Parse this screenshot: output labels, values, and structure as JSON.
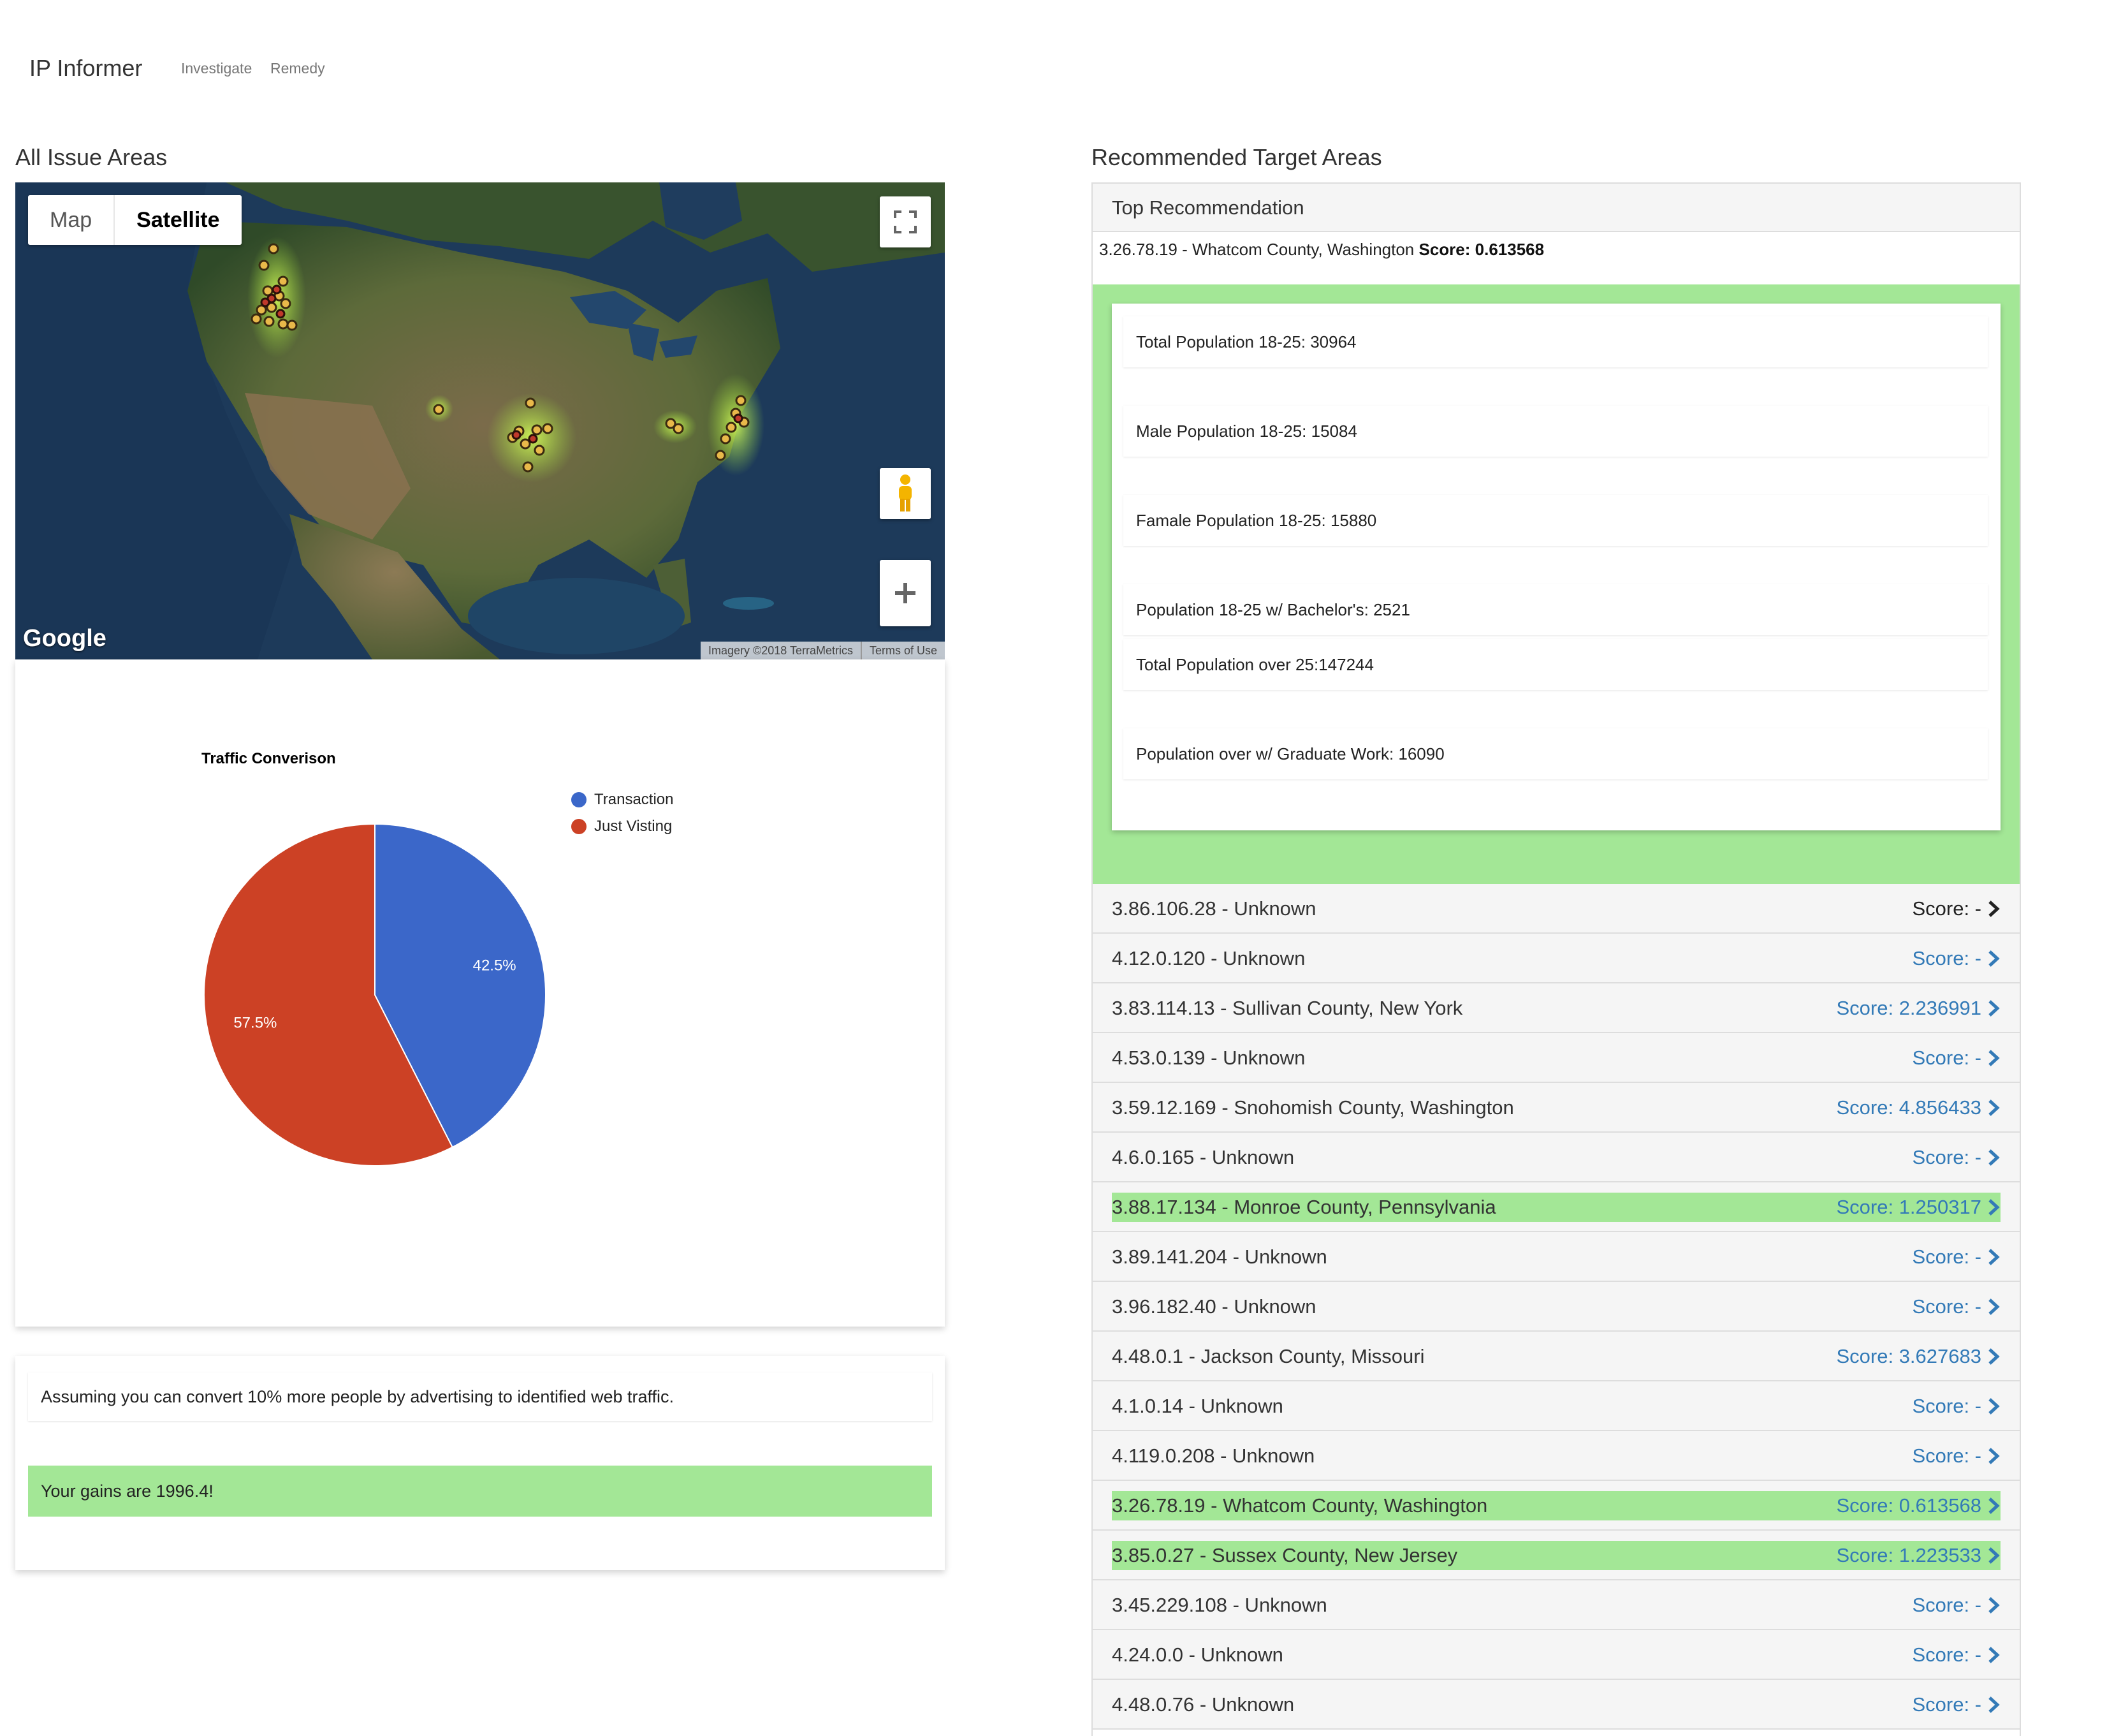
{
  "nav": {
    "brand": "IP Informer",
    "links": [
      "Investigate",
      "Remedy"
    ]
  },
  "left": {
    "title": "All Issue Areas",
    "map": {
      "type_buttons": [
        "Map",
        "Satellite"
      ],
      "active_type": "Satellite",
      "logo": "Google",
      "attribution": "Imagery ©2018 TerraMetrics",
      "terms": "Terms of Use",
      "controls": [
        "fullscreen-icon",
        "pegman-icon",
        "zoom-in-icon"
      ]
    },
    "chart": {
      "title": "Traffic Converison",
      "legend": [
        "Transaction",
        "Just Visting"
      ],
      "slice_labels": [
        "42.5%",
        "57.5%"
      ]
    },
    "gains": {
      "assumption": "Assuming you can convert 10% more people by advertising to identified web traffic.",
      "result": "Your gains are 1996.4!"
    }
  },
  "right": {
    "title": "Recommended Target Areas",
    "top_header": "Top Recommendation",
    "top_ip": "3.26.78.19 - Whatcom County, Washington",
    "top_score_label": "Score: 0.613568",
    "stats": [
      "Total Population 18-25: 30964",
      "Male Population 18-25: 15084",
      "Famale Population 18-25: 15880",
      "Population 18-25 w/ Bachelor's: 2521",
      "Total Population over 25:147244",
      "Population over w/ Graduate Work: 16090"
    ],
    "rows": [
      {
        "label": "3.86.106.28 - Unknown",
        "score": "Score: -",
        "highlight": false
      },
      {
        "label": "4.12.0.120 - Unknown",
        "score": "Score: -",
        "highlight": false
      },
      {
        "label": "3.83.114.13 - Sullivan County, New York",
        "score": "Score: 2.236991",
        "highlight": false
      },
      {
        "label": "4.53.0.139 - Unknown",
        "score": "Score: -",
        "highlight": false
      },
      {
        "label": "3.59.12.169 - Snohomish County, Washington",
        "score": "Score: 4.856433",
        "highlight": false
      },
      {
        "label": "4.6.0.165 - Unknown",
        "score": "Score: -",
        "highlight": false
      },
      {
        "label": "3.88.17.134 - Monroe County, Pennsylvania",
        "score": "Score: 1.250317",
        "highlight": true
      },
      {
        "label": "3.89.141.204 - Unknown",
        "score": "Score: -",
        "highlight": false
      },
      {
        "label": "3.96.182.40 - Unknown",
        "score": "Score: -",
        "highlight": false
      },
      {
        "label": "4.48.0.1 - Jackson County, Missouri",
        "score": "Score: 3.627683",
        "highlight": false
      },
      {
        "label": "4.1.0.14 - Unknown",
        "score": "Score: -",
        "highlight": false
      },
      {
        "label": "4.119.0.208 - Unknown",
        "score": "Score: -",
        "highlight": false
      },
      {
        "label": "3.26.78.19 - Whatcom County, Washington",
        "score": "Score: 0.613568",
        "highlight": true
      },
      {
        "label": "3.85.0.27 - Sussex County, New Jersey",
        "score": "Score: 1.223533",
        "highlight": true
      },
      {
        "label": "3.45.229.108 - Unknown",
        "score": "Score: -",
        "highlight": false
      },
      {
        "label": "4.24.0.0 - Unknown",
        "score": "Score: -",
        "highlight": false
      },
      {
        "label": "4.48.0.76 - Unknown",
        "score": "Score: -",
        "highlight": false
      }
    ]
  },
  "chart_data": {
    "type": "pie",
    "title": "Traffic Converison",
    "categories": [
      "Transaction",
      "Just Visting"
    ],
    "values": [
      42.5,
      57.5
    ],
    "colors": [
      "#3b67c9",
      "#cc4125"
    ],
    "legend_position": "top-right"
  },
  "colors": {
    "highlight": "#a3e796",
    "link": "#337ab7",
    "panel_bg": "#f5f5f5"
  }
}
